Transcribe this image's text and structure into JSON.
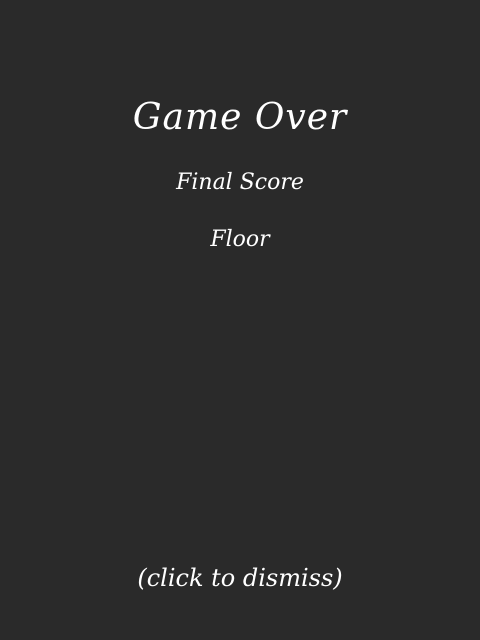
{
  "game_over": {
    "title": "Game Over",
    "final_score_label": "Final Score",
    "floor_label": "Floor",
    "dismiss_hint": "(click to dismiss)"
  },
  "colors": {
    "background": "#2a2a2a",
    "text": "#ffffff"
  }
}
